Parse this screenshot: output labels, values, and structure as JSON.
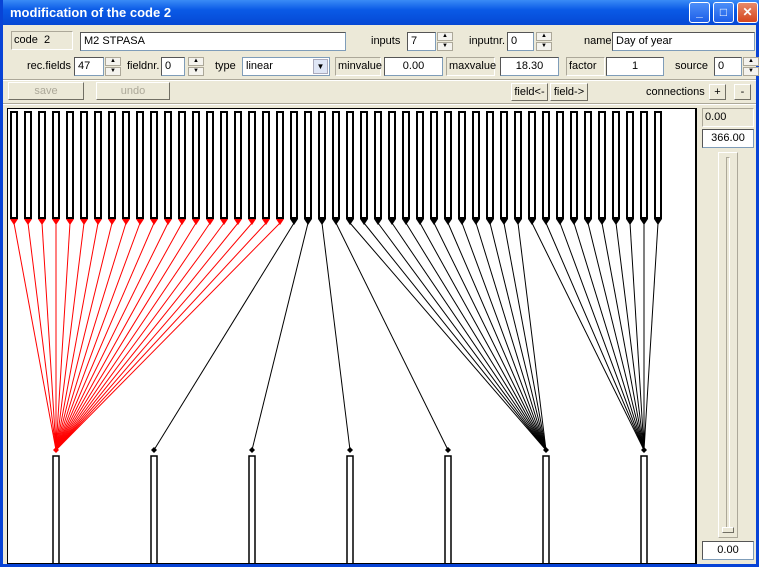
{
  "window": {
    "title": "modification of the code 2",
    "minimize": "_",
    "maximize": "□",
    "close": "✕"
  },
  "row1": {
    "code_label": "code  2",
    "code_name": "M2 STPASA",
    "inputs_label": "inputs",
    "inputs_value": "7",
    "inputnr_label": "inputnr.",
    "inputnr_value": "0",
    "name_label": "name",
    "name_value": "Day of year"
  },
  "row2": {
    "recfields_label": "rec.fields",
    "recfields_value": "47",
    "fieldnr_label": "fieldnr.",
    "fieldnr_value": "0",
    "type_label": "type",
    "type_value": "linear",
    "minvalue_label": "minvalue",
    "minvalue_value": "0.00",
    "maxvalue_label": "maxvalue",
    "maxvalue_value": "18.30",
    "factor_label": "factor",
    "factor_value": "1",
    "source_label": "source",
    "source_value": "0"
  },
  "toolbar": {
    "save": "save",
    "undo": "undo",
    "field_prev": "field<-",
    "field_next": "field->",
    "connections_label": "connections",
    "plus": "+",
    "minus": "-"
  },
  "range": {
    "min_label": "0.00",
    "max_value": "366.00",
    "current_value": "0.00",
    "slider_fraction": 0.0
  },
  "diagram": {
    "field_count": 47,
    "input_count": 7,
    "selected_input": 0,
    "highlight_color": "#ff0000",
    "line_color": "#000000",
    "connections": [
      0,
      0,
      0,
      0,
      0,
      0,
      0,
      0,
      0,
      0,
      0,
      0,
      0,
      0,
      0,
      0,
      0,
      0,
      0,
      0,
      1,
      2,
      3,
      4,
      5,
      5,
      5,
      5,
      5,
      5,
      5,
      5,
      5,
      5,
      5,
      5,
      5,
      6,
      6,
      6,
      6,
      6,
      6,
      6,
      6,
      6,
      6
    ]
  }
}
